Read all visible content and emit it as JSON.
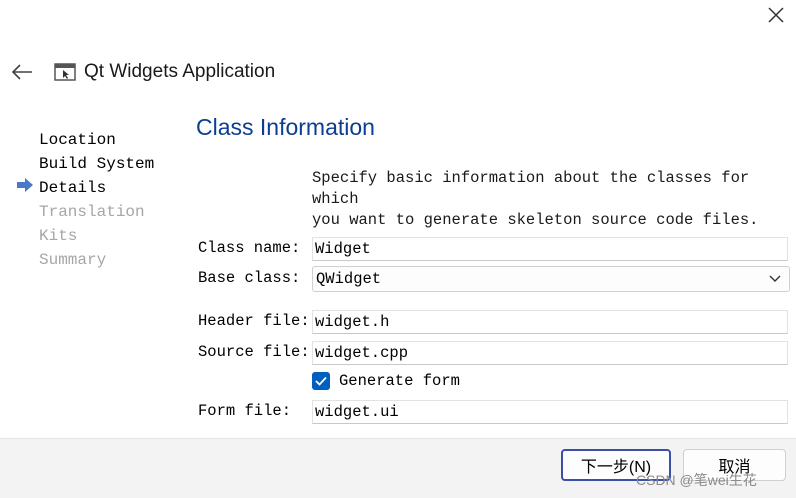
{
  "window": {
    "title": "Qt Widgets Application"
  },
  "steps": [
    {
      "label": "Location",
      "state": "done"
    },
    {
      "label": "Build System",
      "state": "done"
    },
    {
      "label": "Details",
      "state": "current"
    },
    {
      "label": "Translation",
      "state": "pending"
    },
    {
      "label": "Kits",
      "state": "pending"
    },
    {
      "label": "Summary",
      "state": "pending"
    }
  ],
  "page": {
    "title": "Class Information",
    "description_line1": "Specify basic information about the classes for which",
    "description_line2": "you want to generate skeleton source code files."
  },
  "form": {
    "class_name_label": "Class name:",
    "class_name_value": "Widget",
    "base_class_label": "Base class:",
    "base_class_value": "QWidget",
    "header_file_label": "Header file:",
    "header_file_value": "widget.h",
    "source_file_label": "Source file:",
    "source_file_value": "widget.cpp",
    "generate_form_label": "Generate form",
    "generate_form_checked": true,
    "form_file_label": "Form file:",
    "form_file_value": "widget.ui"
  },
  "footer": {
    "next_label": "下一步(N)",
    "cancel_label": "取消"
  },
  "watermark": "CSDN @笔wei生花",
  "colors": {
    "title_blue": "#0b3d91",
    "step_arrow": "#4a78c8",
    "checkbox_blue": "#0060c0",
    "inactive_step": "#a6a6a6"
  }
}
